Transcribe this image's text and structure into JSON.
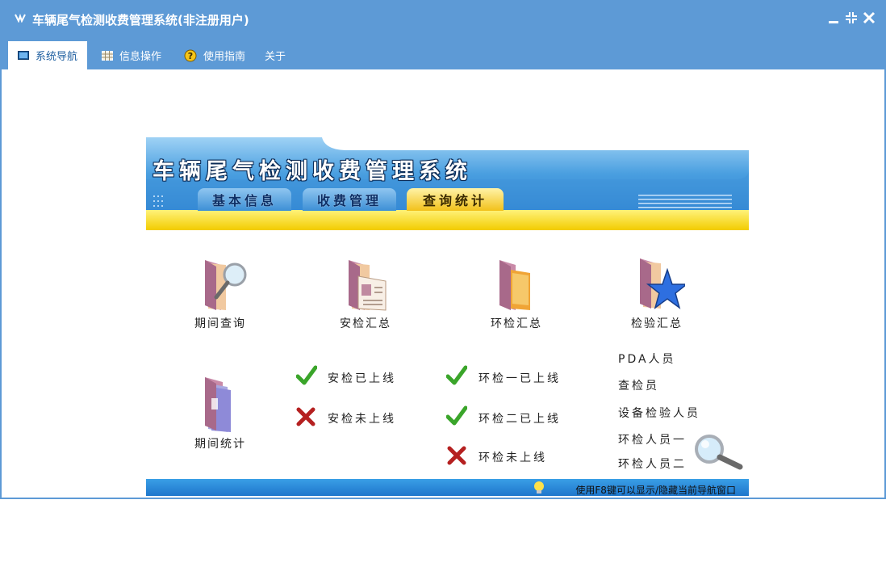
{
  "window": {
    "title": "车辆尾气检测收费管理系统(非注册用户)",
    "controls": {
      "minimize": "minimize-icon",
      "restore": "restore-icon",
      "close": "close-icon"
    }
  },
  "menu": {
    "tabs": [
      {
        "label": "系统导航",
        "icon": "monitor-icon",
        "active": true
      },
      {
        "label": "信息操作",
        "icon": "grid-icon",
        "active": false
      },
      {
        "label": "使用指南",
        "icon": "help-icon",
        "active": false
      },
      {
        "label": "关于",
        "icon": "",
        "active": false
      }
    ]
  },
  "banner": {
    "title": "车辆尾气检测收费管理系统",
    "tabs": [
      {
        "label": "基本信息",
        "active": false
      },
      {
        "label": "收费管理",
        "active": false
      },
      {
        "label": "查询统计",
        "active": true
      }
    ]
  },
  "summary_items": [
    {
      "label": "期间查询",
      "icon": "folder-magnifier-icon"
    },
    {
      "label": "安检汇总",
      "icon": "folder-card-icon"
    },
    {
      "label": "环检汇总",
      "icon": "folder-orange-icon"
    },
    {
      "label": "检验汇总",
      "icon": "folder-star-icon"
    }
  ],
  "stats_item": {
    "label": "期间统计",
    "icon": "folder-documents-icon"
  },
  "safety_status": [
    {
      "label": "安检已上线",
      "icon": "check-icon"
    },
    {
      "label": "安检未上线",
      "icon": "cross-icon"
    }
  ],
  "env_status": [
    {
      "label": "环检一已上线",
      "icon": "check-icon"
    },
    {
      "label": "环检二已上线",
      "icon": "check-icon"
    },
    {
      "label": "环检未上线",
      "icon": "cross-icon"
    }
  ],
  "personnel": [
    "PDA人员",
    "查检员",
    "设备检验人员",
    "环检人员一",
    "环检人员二"
  ],
  "status_bar": {
    "hint": "使用F8键可以显示/隐藏当前导航窗口"
  },
  "colors": {
    "window_blue": "#5d9ad6",
    "banner_blue": "#3d8fd6",
    "yellow": "#f7d400",
    "check_green": "#3aa52a",
    "cross_red": "#b52020"
  }
}
